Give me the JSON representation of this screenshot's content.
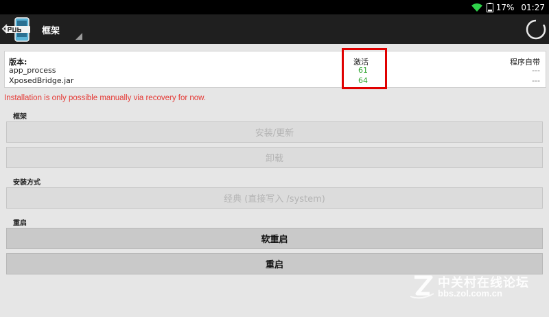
{
  "status_bar": {
    "battery": "17%",
    "time": "01:27"
  },
  "action_bar": {
    "title": "框架"
  },
  "info_table": {
    "header_label": "版本:",
    "header_active": "激活",
    "header_app": "程序自带",
    "rows": [
      {
        "name": "app_process",
        "active": "61",
        "app": "---"
      },
      {
        "name": "XposedBridge.jar",
        "active": "64",
        "app": "---"
      }
    ]
  },
  "warning_text": "Installation is only possible manually via recovery for now.",
  "sections": {
    "framework": {
      "title": "框架",
      "install_update": "安装/更新",
      "uninstall": "卸载"
    },
    "install_method": {
      "title": "安装方式",
      "classic": "经典 (直接写入 /system)"
    },
    "reboot": {
      "title": "重启",
      "soft_reboot": "软重启",
      "reboot": "重启"
    }
  },
  "watermark": {
    "line1": "中关村在线论坛",
    "line2": "bbs.zol.com.cn"
  },
  "colors": {
    "active_version": "#2fa62f",
    "warning": "#e53935",
    "highlight": "#e00000"
  }
}
